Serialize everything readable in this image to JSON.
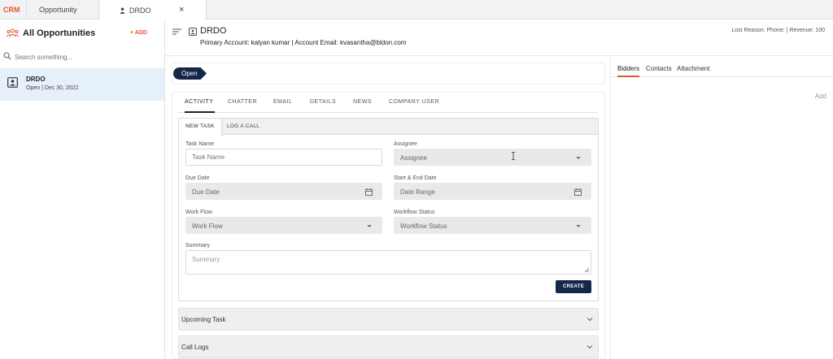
{
  "topbar": {
    "brand": "CRM",
    "tabs": [
      {
        "label": "Opportunity"
      },
      {
        "label": "DRDO"
      }
    ]
  },
  "sidebar": {
    "title": "All Opportunities",
    "add_label": "+ ADD",
    "search_placeholder": "Search something...",
    "items": [
      {
        "name": "DRDO",
        "sub": "Open | Dec 30, 2022"
      }
    ]
  },
  "header": {
    "title": "DRDO",
    "primary_account_label": "Primary Account:",
    "primary_account": "kalyan kumar",
    "separator": "|",
    "email_label": "Account Email:",
    "email": "kvasantha@bldon.com",
    "right_info": "Lost Reason: Phone: | Revenue: 100"
  },
  "status": {
    "label": "Open"
  },
  "activity": {
    "tabs": [
      "ACTIVITY",
      "CHATTER",
      "EMAIL",
      "DETAILS",
      "NEWS",
      "COMPANY USER"
    ],
    "inner_tabs": [
      "NEW TASK",
      "LOG A CALL"
    ],
    "fields": {
      "task_name": {
        "label": "Task Name",
        "placeholder": "Task Name"
      },
      "assignee": {
        "label": "Assignee",
        "value": "Assignee"
      },
      "due_date": {
        "label": "Due Date",
        "value": "Due Date"
      },
      "date_range": {
        "label": "Start & End Date",
        "value": "Date Range"
      },
      "work_flow": {
        "label": "Work Flow",
        "value": "Work Flow"
      },
      "workflow_status": {
        "label": "Workflow Status",
        "value": "Workflow Status"
      },
      "summary": {
        "label": "Summary",
        "placeholder": "Summary"
      }
    },
    "create_label": "CREATE",
    "accordions": [
      "Upcoming Task",
      "Call Logs"
    ]
  },
  "right_panel": {
    "tabs": [
      "Bidders",
      "Contacts",
      "Attachment"
    ],
    "add_label": "Add"
  },
  "colors": {
    "accent": "#e8552b",
    "primary": "#16264a"
  }
}
